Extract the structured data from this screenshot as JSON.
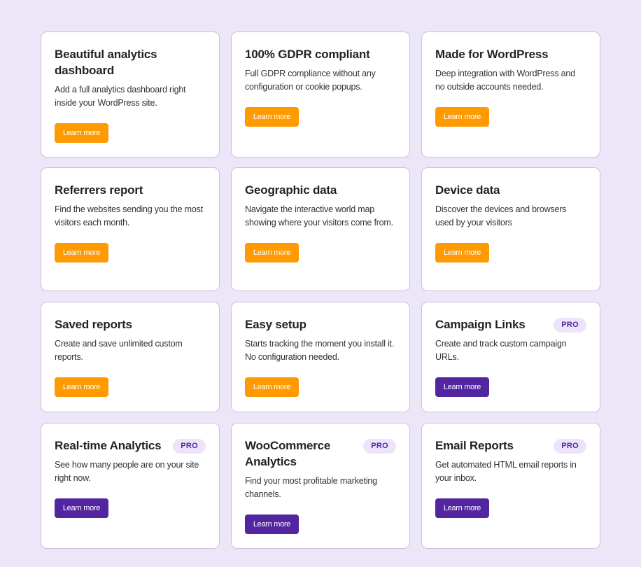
{
  "colors": {
    "background": "#ede6f8",
    "free_button": "#ff9a00",
    "pro_button": "#5326a1",
    "pro_badge_bg": "#ede4fb",
    "pro_badge_text": "#5428a0"
  },
  "features": [
    {
      "title": "Beautiful analytics dashboard",
      "description": "Add a full analytics dashboard right inside your WordPress site.",
      "button": "Learn more",
      "pro": false,
      "badge": ""
    },
    {
      "title": "100% GDPR compliant",
      "description": "Full GDPR compliance without any configuration or cookie popups.",
      "button": "Learn more",
      "pro": false,
      "badge": ""
    },
    {
      "title": "Made for WordPress",
      "description": "Deep integration with WordPress and no outside accounts needed.",
      "button": "Learn more",
      "pro": false,
      "badge": ""
    },
    {
      "title": "Referrers report",
      "description": "Find the websites sending you the most visitors each month.",
      "button": "Learn more",
      "pro": false,
      "badge": ""
    },
    {
      "title": "Geographic data",
      "description": "Navigate the interactive world map showing where your visitors come from.",
      "button": "Learn more",
      "pro": false,
      "badge": ""
    },
    {
      "title": "Device data",
      "description": "Discover the devices and browsers used by your visitors",
      "button": "Learn more",
      "pro": false,
      "badge": ""
    },
    {
      "title": "Saved reports",
      "description": "Create and save unlimited custom reports.",
      "button": "Learn more",
      "pro": false,
      "badge": ""
    },
    {
      "title": "Easy setup",
      "description": "Starts tracking the moment you install it. No configuration needed.",
      "button": "Learn more",
      "pro": false,
      "badge": ""
    },
    {
      "title": "Campaign Links",
      "description": "Create and track custom campaign URLs.",
      "button": "Learn more",
      "pro": true,
      "badge": "PRO"
    },
    {
      "title": "Real-time Analytics",
      "description": "See how many people are on your site right now.",
      "button": "Learn more",
      "pro": true,
      "badge": "PRO"
    },
    {
      "title": "WooCommerce Analytics",
      "description": "Find your most profitable marketing channels.",
      "button": "Learn more",
      "pro": true,
      "badge": "PRO"
    },
    {
      "title": "Email Reports",
      "description": "Get automated HTML email reports in your inbox.",
      "button": "Learn more",
      "pro": true,
      "badge": "PRO"
    }
  ]
}
